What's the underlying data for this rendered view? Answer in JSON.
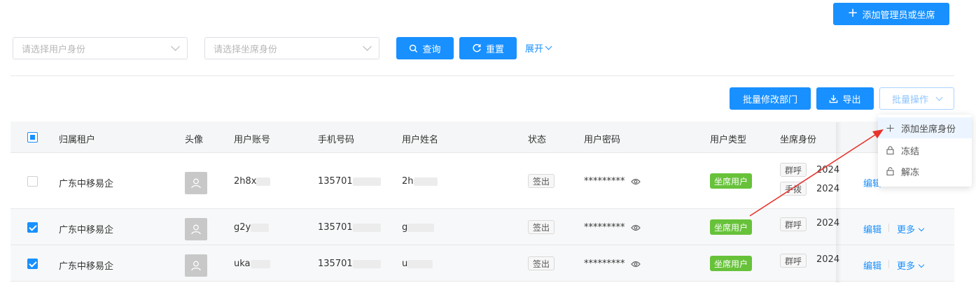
{
  "header": {
    "add_admin_label": "添加管理员或坐席"
  },
  "filters": {
    "user_identity_placeholder": "请选择用户身份",
    "seat_identity_placeholder": "请选择坐席身份",
    "search_label": "查询",
    "reset_label": "重置",
    "expand_label": "展开"
  },
  "toolbar": {
    "batch_dept_label": "批量修改部门",
    "export_label": "导出",
    "batch_ops_label": "批量操作"
  },
  "table": {
    "columns": {
      "tenant": "归属租户",
      "avatar": "头像",
      "account": "用户账号",
      "phone": "手机号码",
      "name": "用户姓名",
      "status": "状态",
      "password": "用户密码",
      "user_type": "用户类型",
      "seat_identity": "坐席身份"
    },
    "rows": [
      {
        "checked": false,
        "tenant": "广东中移易企",
        "account": "2h8x",
        "phone": "135701",
        "name": "2h",
        "status": "签出",
        "password": "*********",
        "user_type": "坐席用户",
        "seat_tags": [
          "群呼",
          "手拨"
        ],
        "seat_years": [
          "2024",
          "2024"
        ],
        "edit": "编辑",
        "more": ""
      },
      {
        "checked": true,
        "tenant": "广东中移易企",
        "account": "g2y",
        "phone": "135701",
        "name": "g",
        "status": "签出",
        "password": "*********",
        "user_type": "坐席用户",
        "seat_tags": [
          "群呼"
        ],
        "seat_years": [
          "2024"
        ],
        "edit": "编辑",
        "more": "更多"
      },
      {
        "checked": true,
        "tenant": "广东中移易企",
        "account": "uka",
        "phone": "135701",
        "name": "u",
        "status": "签出",
        "password": "*********",
        "user_type": "坐席用户",
        "seat_tags": [
          "群呼"
        ],
        "seat_years": [
          "2024"
        ],
        "edit": "编辑",
        "more": "更多"
      }
    ]
  },
  "dropdown": {
    "items": [
      {
        "label": "添加坐席身份",
        "icon": "plus-icon"
      },
      {
        "label": "冻结",
        "icon": "lock-icon"
      },
      {
        "label": "解冻",
        "icon": "unlock-icon"
      }
    ]
  },
  "colors": {
    "primary": "#1890ff",
    "success": "#67c23a",
    "annotation": "#e8322b"
  }
}
